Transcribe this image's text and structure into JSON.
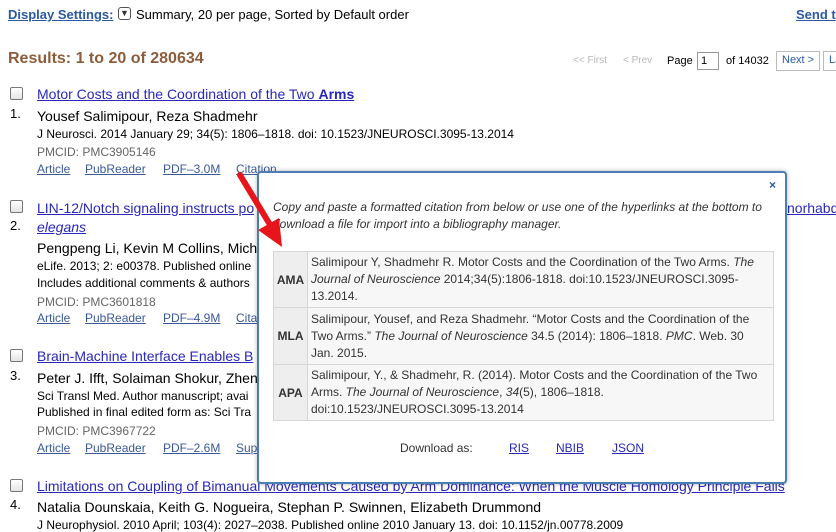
{
  "header": {
    "display_settings": "Display Settings:",
    "settings_summary": "Summary, 20 per page, Sorted by Default order",
    "send_to": "Send t"
  },
  "results_heading": "Results: 1 to 20 of 280634",
  "pager": {
    "first": "<< First",
    "prev": "< Prev",
    "page_label": "Page",
    "page_value": "1",
    "of_pages": "of 14032",
    "next": "Next >",
    "last": "La"
  },
  "results": [
    {
      "num": "1.",
      "title_prefix": "Motor Costs and the Coordination of the Two ",
      "title_bold": "Arms",
      "authors": "Yousef Salimipour, Reza Shadmehr",
      "citation": "J Neurosci. 2014 January 29; 34(5): 1806–1818. doi: 10.1523/JNEUROSCI.3095-13.2014",
      "pmcid": "PMCID: PMC3905146",
      "links": [
        "Article",
        "PubReader",
        "PDF–3.0M",
        "Citation"
      ]
    },
    {
      "num": "2.",
      "title_a": "LIN-12/Notch signaling instructs po",
      "title_b": "norhabd",
      "title_line2": "elegans",
      "authors": "Pengpeng Li, Kevin M Collins, Mich",
      "citation": "eLife. 2013; 2: e00378. Published online",
      "extra": "Includes additional comments & authors",
      "pmcid": "PMCID: PMC3601818",
      "links": [
        "Article",
        "PubReader",
        "PDF–4.9M",
        "Cita"
      ]
    },
    {
      "num": "3.",
      "title": "Brain-Machine Interface Enables B",
      "authors": "Peter J. Ifft, Solaiman Shokur, Zhen",
      "citation": "Sci Transl Med. Author manuscript; avai",
      "extra": "Published in final edited form as: Sci Tra",
      "pmcid": "PMCID: PMC3967722",
      "links": [
        "Article",
        "PubReader",
        "PDF–2.6M",
        "Sup"
      ]
    },
    {
      "num": "4.",
      "title": "Limitations on Coupling of Bimanual Movements Caused by Arm Dominance: When the Muscle Homology Principle Fails",
      "authors": "Natalia Dounskaia, Keith G. Nogueira, Stephan P. Swinnen, Elizabeth Drummond",
      "citation": "J Neurophysiol. 2010 April; 103(4): 2027–2038. Published online 2010 January 13. doi: 10.1152/jn.00778.2009"
    }
  ],
  "popup": {
    "close": "×",
    "intro": "Copy and paste a formatted citation from below or use one of the hyperlinks at the bottom to download a file for import into a bibliography manager.",
    "ama": {
      "label": "AMA",
      "pre": "Salimipour Y, Shadmehr R. Motor Costs and the Coordination of the Two Arms. ",
      "journal": "The Journal of Neuroscience",
      "post": " 2014;34(5):1806-1818. doi:10.1523/JNEUROSCI.3095-13.2014."
    },
    "mla": {
      "label": "MLA",
      "pre": "Salimipour, Yousef, and Reza Shadmehr. “Motor Costs and the Coordination of the Two Arms.” ",
      "journal": "The Journal of Neuroscience",
      "mid": " 34.5 (2014): 1806–1818. ",
      "pmc": "PMC",
      "post": ". Web. 30 Jan. 2015."
    },
    "apa": {
      "label": "APA",
      "pre": "Salimipour, Y., & Shadmehr, R. (2014). Motor Costs and the Coordination of the Two Arms. ",
      "journal": "The Journal of Neuroscience",
      "sep": ", ",
      "vol": "34",
      "post": "(5), 1806–1818. doi:10.1523/JNEUROSCI.3095-13.2014"
    },
    "download_label": "Download as:",
    "download_links": [
      "RIS",
      "NBIB",
      "JSON"
    ]
  },
  "colors": {
    "link": "#2a28ba",
    "results_heading": "#8d5d3b",
    "popup_border": "#4a7fb5",
    "arrow": "#e8141b"
  }
}
